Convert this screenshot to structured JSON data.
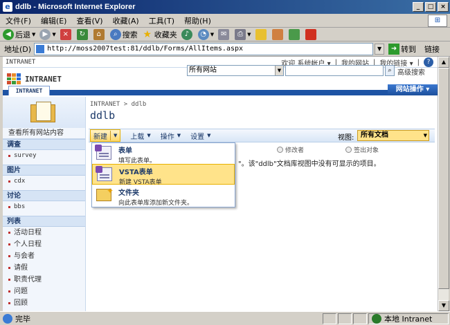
{
  "window": {
    "title": "ddlb - Microsoft Internet Explorer",
    "controls": [
      "_",
      "□",
      "×"
    ]
  },
  "menubar": [
    "文件(F)",
    "编辑(E)",
    "查看(V)",
    "收藏(A)",
    "工具(T)",
    "帮助(H)"
  ],
  "toolbar": {
    "back": "后退",
    "search": "搜索",
    "favorites": "收藏夹"
  },
  "address": {
    "label": "地址(D)",
    "url": "http://moss2007test:81/ddlb/Forms/AllItems.aspx",
    "go": "转到",
    "links": "链接"
  },
  "sp": {
    "site_label": "INTRANET",
    "welcome": "欢迎 系统帐户 ▾",
    "my_site": "我的网站",
    "my_links": "我的链接 ▾",
    "logo_name": "INTRANET",
    "scope": "所有网站",
    "advanced_search": "高级搜索",
    "tab": "INTRANET",
    "site_actions": "网站操作 ▾"
  },
  "leftnav": {
    "view_all": "查看所有网站内容",
    "sections": [
      {
        "title": "调查",
        "items": [
          "survey"
        ]
      },
      {
        "title": "图片",
        "items": [
          "cdx"
        ]
      },
      {
        "title": "讨论",
        "items": [
          "bbs"
        ]
      },
      {
        "title": "列表",
        "items": [
          "活动日程",
          "个人日程",
          "与会者",
          "请假",
          "职责代理",
          "问题",
          "回顾"
        ]
      }
    ]
  },
  "main": {
    "breadcrumb": "INTRANET > ddlb",
    "title": "ddlb",
    "toolbar": {
      "new": "新建",
      "upload": "上载",
      "actions": "操作",
      "settings": "设置",
      "view_label": "视图:",
      "view_value": "所有文档"
    },
    "columns": [
      "修改者",
      "签出对象"
    ],
    "empty_message": "\"。该\"ddlb\"文档库视图中没有可显示的项目。"
  },
  "new_menu": [
    {
      "title": "表单",
      "desc": "填写此表单。"
    },
    {
      "title": "VSTA表单",
      "desc": "新建 VSTA表单"
    },
    {
      "title": "文件夹",
      "desc": "向此表单库添加新文件夹。"
    }
  ],
  "status": {
    "text": "完毕",
    "zone": "本地 Intranet"
  }
}
